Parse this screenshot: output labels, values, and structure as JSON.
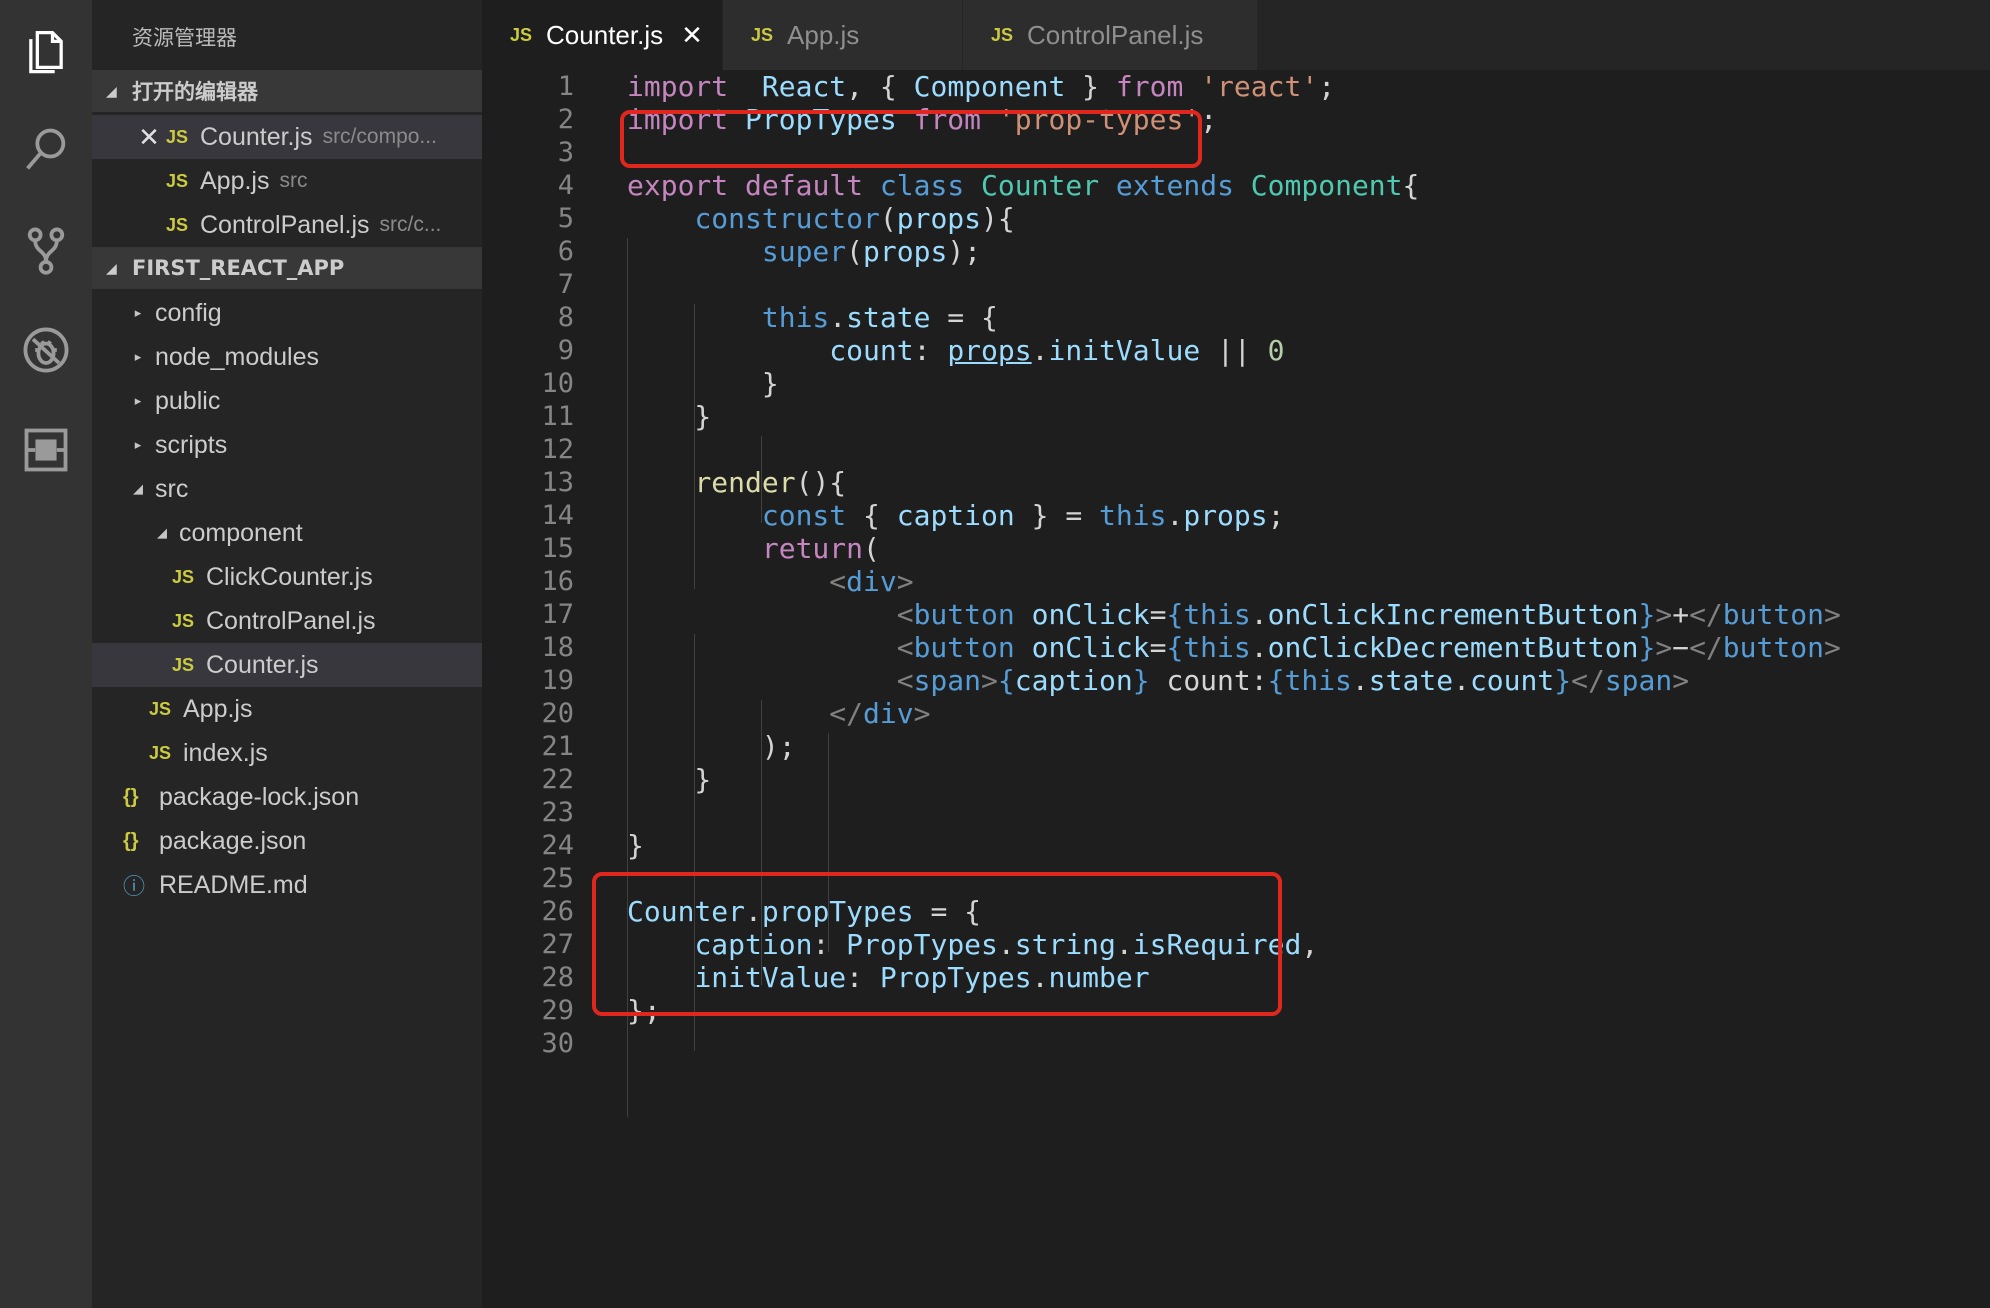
{
  "colors": {
    "accent_box": "#e0271e",
    "js_badge": "#cbcb41",
    "info_badge": "#519aba"
  },
  "activity_bar": [
    {
      "icon": "files-icon"
    },
    {
      "icon": "search-icon"
    },
    {
      "icon": "source-control-icon"
    },
    {
      "icon": "debug-icon"
    },
    {
      "icon": "extensions-icon"
    }
  ],
  "sidebar": {
    "title": "资源管理器",
    "open_editors": {
      "label": "打开的编辑器",
      "items": [
        {
          "name": "Counter.js",
          "hint": "src/compo...",
          "badge": "JS",
          "close": "✕"
        },
        {
          "name": "App.js",
          "hint": "src",
          "badge": "JS"
        },
        {
          "name": "ControlPanel.js",
          "hint": "src/c...",
          "badge": "JS"
        }
      ]
    },
    "project": {
      "label": "FIRST_REACT_APP",
      "tree": [
        {
          "name": "config",
          "badge": "▸"
        },
        {
          "name": "node_modules",
          "badge": "▸"
        },
        {
          "name": "public",
          "badge": "▸"
        },
        {
          "name": "scripts",
          "badge": "▸"
        },
        {
          "name": "src",
          "badge": "◢"
        },
        {
          "name": "component",
          "badge": "◢"
        },
        {
          "name": "ClickCounter.js",
          "badge": "JS"
        },
        {
          "name": "ControlPanel.js",
          "badge": "JS"
        },
        {
          "name": "Counter.js",
          "badge": "JS"
        },
        {
          "name": "App.js",
          "badge": "JS"
        },
        {
          "name": "index.js",
          "badge": "JS"
        },
        {
          "name": "package-lock.json",
          "badge": "{}"
        },
        {
          "name": "package.json",
          "badge": "{}"
        },
        {
          "name": "README.md",
          "badge": "ⓘ"
        }
      ]
    }
  },
  "tabs": [
    {
      "label": "Counter.js",
      "badge": "JS",
      "close": "✕"
    },
    {
      "label": "App.js",
      "badge": "JS"
    },
    {
      "label": "ControlPanel.js",
      "badge": "JS"
    }
  ],
  "editor": {
    "line_numbers": [
      "1",
      "2",
      "3",
      "4",
      "5",
      "6",
      "7",
      "8",
      "9",
      "10",
      "11",
      "12",
      "13",
      "14",
      "15",
      "16",
      "17",
      "18",
      "19",
      "20",
      "21",
      "22",
      "23",
      "24",
      "25",
      "26",
      "27",
      "28",
      "29",
      "30"
    ],
    "lines": [
      [
        [
          "kw",
          "import"
        ],
        [
          "",
          "  "
        ],
        [
          "vr",
          "React"
        ],
        [
          "",
          ", { "
        ],
        [
          "vr",
          "Component"
        ],
        [
          "",
          " } "
        ],
        [
          "kw",
          "from"
        ],
        [
          "st",
          " 'react'"
        ],
        [
          "",
          ";"
        ]
      ],
      [
        [
          "kw",
          "import"
        ],
        [
          "",
          " "
        ],
        [
          "vr",
          "PropTypes"
        ],
        [
          "",
          " "
        ],
        [
          "kw",
          "from"
        ],
        [
          "",
          " "
        ],
        [
          "st",
          "'prop-types'"
        ],
        [
          "",
          ";"
        ]
      ],
      [],
      [
        [
          "kw",
          "export"
        ],
        [
          "",
          " "
        ],
        [
          "kw",
          "default"
        ],
        [
          "",
          " "
        ],
        [
          "kb",
          "class"
        ],
        [
          "",
          " "
        ],
        [
          "ty",
          "Counter"
        ],
        [
          "",
          " "
        ],
        [
          "kb",
          "extends"
        ],
        [
          "",
          " "
        ],
        [
          "ty",
          "Component"
        ],
        [
          "",
          "{"
        ]
      ],
      [
        [
          "",
          "    "
        ],
        [
          "kb",
          "constructor"
        ],
        [
          "",
          "("
        ],
        [
          "vr",
          "props"
        ],
        [
          "",
          "){"
        ]
      ],
      [
        [
          "",
          "        "
        ],
        [
          "kb",
          "super"
        ],
        [
          "",
          "("
        ],
        [
          "vr",
          "props"
        ],
        [
          "",
          ");"
        ]
      ],
      [],
      [
        [
          "",
          "        "
        ],
        [
          "kb",
          "this"
        ],
        [
          "",
          "."
        ],
        [
          "vr",
          "state"
        ],
        [
          "",
          " = {"
        ]
      ],
      [
        [
          "",
          "            "
        ],
        [
          "vr",
          "count"
        ],
        [
          "",
          ": "
        ],
        [
          "vr un",
          "props"
        ],
        [
          "",
          "."
        ],
        [
          "vr",
          "initValue"
        ],
        [
          "",
          " || "
        ],
        [
          "nm",
          "0"
        ]
      ],
      [
        [
          "",
          "        }"
        ]
      ],
      [
        [
          "",
          "    }"
        ]
      ],
      [],
      [
        [
          "",
          "    "
        ],
        [
          "fn",
          "render"
        ],
        [
          "",
          "(){"
        ]
      ],
      [
        [
          "",
          "        "
        ],
        [
          "kb",
          "const"
        ],
        [
          "",
          " { "
        ],
        [
          "vr",
          "caption"
        ],
        [
          "",
          " } = "
        ],
        [
          "kb",
          "this"
        ],
        [
          "",
          "."
        ],
        [
          "vr",
          "props"
        ],
        [
          "",
          ";"
        ]
      ],
      [
        [
          "",
          "        "
        ],
        [
          "kw",
          "return"
        ],
        [
          "",
          "("
        ]
      ],
      [
        [
          "",
          "            "
        ],
        [
          "br",
          "<"
        ],
        [
          "tg",
          "div"
        ],
        [
          "br",
          ">"
        ]
      ],
      [
        [
          "",
          "                "
        ],
        [
          "br",
          "<"
        ],
        [
          "tg",
          "button"
        ],
        [
          "",
          " "
        ],
        [
          "vr",
          "onClick"
        ],
        [
          "",
          "="
        ],
        [
          "kb",
          "{"
        ],
        [
          "kb",
          "this"
        ],
        [
          "",
          "."
        ],
        [
          "vr",
          "onClickIncrementButton"
        ],
        [
          "kb",
          "}"
        ],
        [
          "br",
          ">"
        ],
        [
          "",
          "+"
        ],
        [
          "br",
          "</"
        ],
        [
          "tg",
          "button"
        ],
        [
          "br",
          ">"
        ]
      ],
      [
        [
          "",
          "                "
        ],
        [
          "br",
          "<"
        ],
        [
          "tg",
          "button"
        ],
        [
          "",
          " "
        ],
        [
          "vr",
          "onClick"
        ],
        [
          "",
          "="
        ],
        [
          "kb",
          "{"
        ],
        [
          "kb",
          "this"
        ],
        [
          "",
          "."
        ],
        [
          "vr",
          "onClickDecrementButton"
        ],
        [
          "kb",
          "}"
        ],
        [
          "br",
          ">"
        ],
        [
          "",
          "−"
        ],
        [
          "br",
          "</"
        ],
        [
          "tg",
          "button"
        ],
        [
          "br",
          ">"
        ]
      ],
      [
        [
          "",
          "                "
        ],
        [
          "br",
          "<"
        ],
        [
          "tg",
          "span"
        ],
        [
          "br",
          ">"
        ],
        [
          "kb",
          "{"
        ],
        [
          "vr",
          "caption"
        ],
        [
          "kb",
          "}"
        ],
        [
          "",
          " count:"
        ],
        [
          "kb",
          "{"
        ],
        [
          "kb",
          "this"
        ],
        [
          "",
          "."
        ],
        [
          "vr",
          "state"
        ],
        [
          "",
          "."
        ],
        [
          "vr",
          "count"
        ],
        [
          "kb",
          "}"
        ],
        [
          "br",
          "</"
        ],
        [
          "tg",
          "span"
        ],
        [
          "br",
          ">"
        ]
      ],
      [
        [
          "",
          "            "
        ],
        [
          "br",
          "</"
        ],
        [
          "tg",
          "div"
        ],
        [
          "br",
          ">"
        ]
      ],
      [
        [
          "",
          "        );"
        ]
      ],
      [
        [
          "",
          "    }"
        ]
      ],
      [],
      [
        [
          "",
          "}"
        ]
      ],
      [],
      [
        [
          "vr",
          "Counter"
        ],
        [
          "",
          "."
        ],
        [
          "vr",
          "propTypes"
        ],
        [
          "",
          " = {"
        ]
      ],
      [
        [
          "",
          "    "
        ],
        [
          "vr",
          "caption"
        ],
        [
          "",
          ": "
        ],
        [
          "vr",
          "PropTypes"
        ],
        [
          "",
          "."
        ],
        [
          "vr",
          "string"
        ],
        [
          "",
          "."
        ],
        [
          "vr",
          "isRequired"
        ],
        [
          "",
          ","
        ]
      ],
      [
        [
          "",
          "    "
        ],
        [
          "vr",
          "initValue"
        ],
        [
          "",
          ": "
        ],
        [
          "vr",
          "PropTypes"
        ],
        [
          "",
          "."
        ],
        [
          "vr",
          "number"
        ]
      ],
      [
        [
          "",
          "};"
        ]
      ],
      []
    ]
  }
}
